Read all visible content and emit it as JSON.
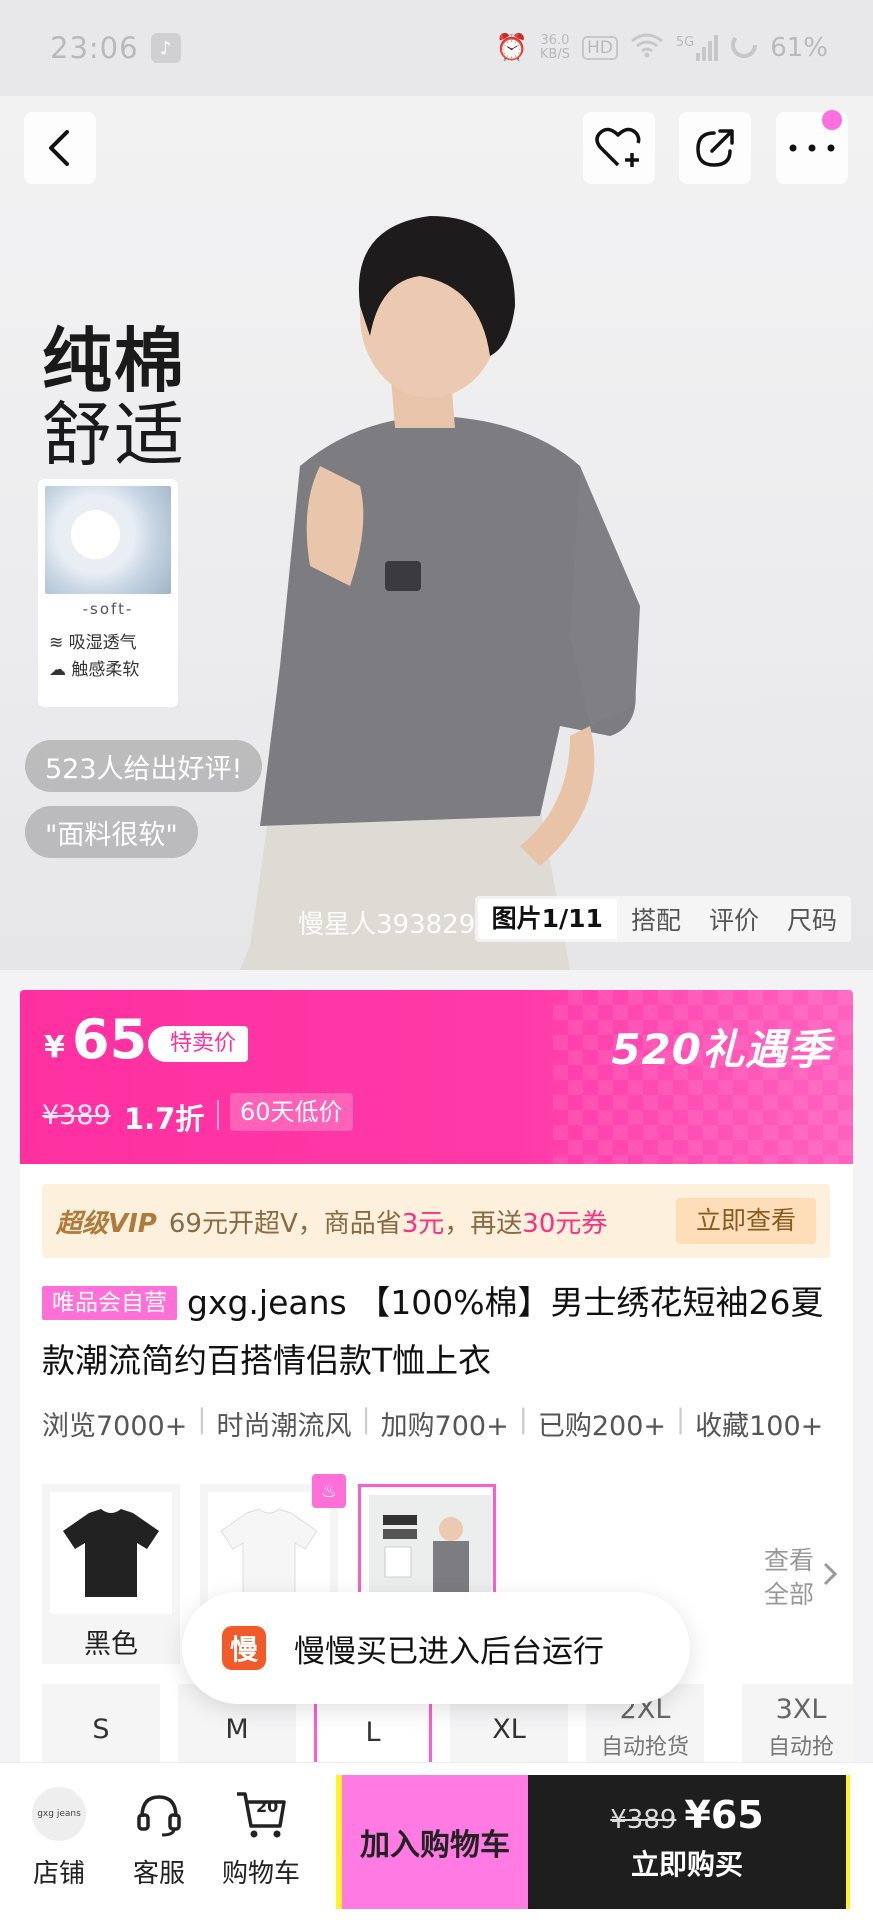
{
  "status_bar": {
    "time": "23:06",
    "net_speed": "36.0",
    "net_unit": "KB/S",
    "hd": "HD",
    "network": "5G",
    "battery": "61%"
  },
  "hero": {
    "headline_line1": "纯棉",
    "headline_line2": "舒适",
    "cotton_soft": "-soft-",
    "cotton_features": [
      "吸湿透气",
      "触感柔软"
    ],
    "reviews_pill": "523人给出好评!",
    "quote_pill": "\"面料很软\"",
    "watermark": "慢星人393829",
    "tabs": [
      "图片1/11",
      "搭配",
      "评价",
      "尺码"
    ],
    "active_tab": 0
  },
  "price_banner": {
    "currency": "¥",
    "price": "65",
    "tag": "特卖价",
    "event": "520礼遇季",
    "original_price": "¥389",
    "discount": "1.7折",
    "low_price": "60天低价"
  },
  "vip": {
    "title": "超级VIP",
    "text_a": "69元开超V，商品省",
    "save_amount": "3元",
    "text_b": "，再送",
    "coupon": "30元券",
    "button": "立即查看"
  },
  "product": {
    "badge": "唯品会自营",
    "title": "gxg.jeans 【100%棉】男士绣花短袖26夏款潮流简约百搭情侣款T恤上衣",
    "stats": [
      "浏览7000+",
      "时尚潮流风",
      "加购700+",
      "已购200+",
      "收藏100+"
    ]
  },
  "variants": {
    "colors": [
      "黑色",
      "",
      ""
    ],
    "selected": 2,
    "see_all_line1": "查看",
    "see_all_line2": "全部"
  },
  "sizes": [
    {
      "name": "S",
      "sub": ""
    },
    {
      "name": "M",
      "sub": ""
    },
    {
      "name": "L",
      "sub": ""
    },
    {
      "name": "XL",
      "sub": ""
    },
    {
      "name": "2XL",
      "sub": "自动抢货"
    },
    {
      "name": "3XL",
      "sub": "自动抢"
    }
  ],
  "toast": {
    "icon_char": "慢",
    "text": "慢慢买已进入后台运行"
  },
  "bottom_bar": {
    "shop_logo_text": "gxg jeans",
    "shop": "店铺",
    "service": "客服",
    "cart": "购物车",
    "cart_count": "20",
    "add_to_cart": "加入购物车",
    "buy_original": "¥389",
    "buy_price": "¥65",
    "buy_now": "立即购买"
  },
  "colors": {
    "accent_pink": "#ff2fa0",
    "highlight_yellow": "#fff12a",
    "buy_dark": "#1e1e1e"
  }
}
